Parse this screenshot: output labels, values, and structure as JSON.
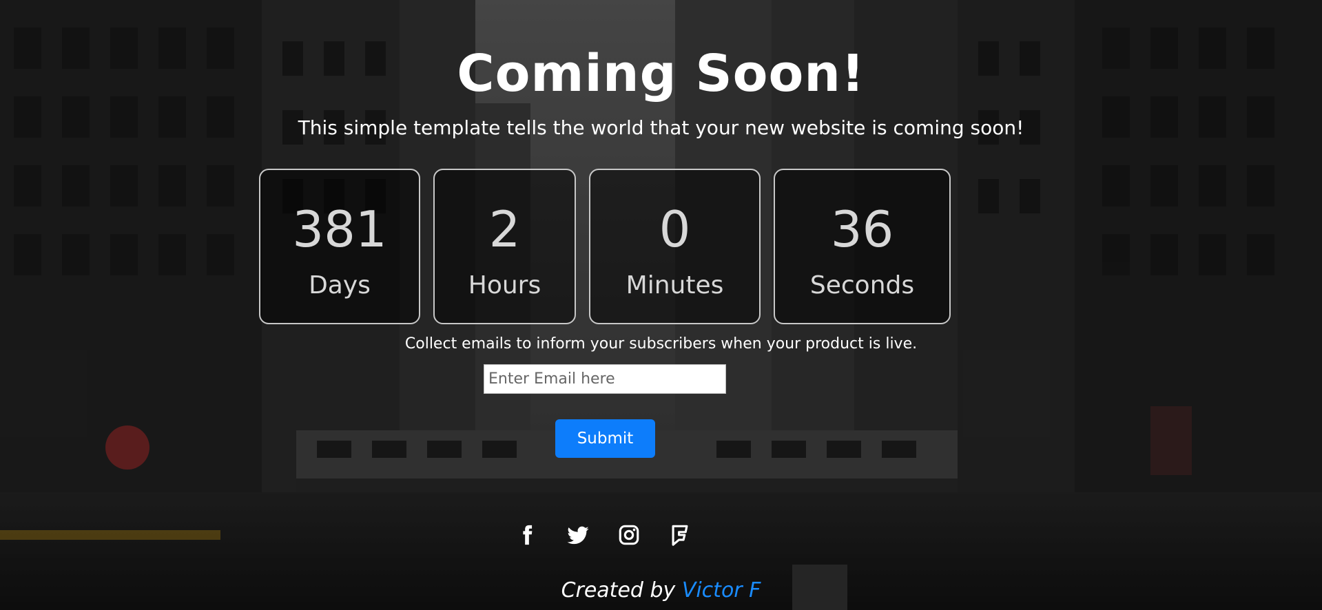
{
  "title": "Coming Soon!",
  "subtitle": "This simple template tells the world that your new website is coming soon!",
  "countdown": [
    {
      "value": "381",
      "label": "Days"
    },
    {
      "value": "2",
      "label": "Hours"
    },
    {
      "value": "0",
      "label": "Minutes"
    },
    {
      "value": "36",
      "label": "Seconds"
    }
  ],
  "subscribe": {
    "prompt": "Collect emails to inform your subscribers when your product is live.",
    "email_placeholder": "Enter Email here",
    "submit_label": "Submit"
  },
  "socials": [
    "facebook-icon",
    "twitter-icon",
    "instagram-icon",
    "foursquare-icon"
  ],
  "footer": {
    "prefix": "Created by",
    "author": "Victor F"
  },
  "colors": {
    "accent": "#0d7dfb",
    "link": "#1a8cff",
    "box_border": "#c8c8c8"
  }
}
